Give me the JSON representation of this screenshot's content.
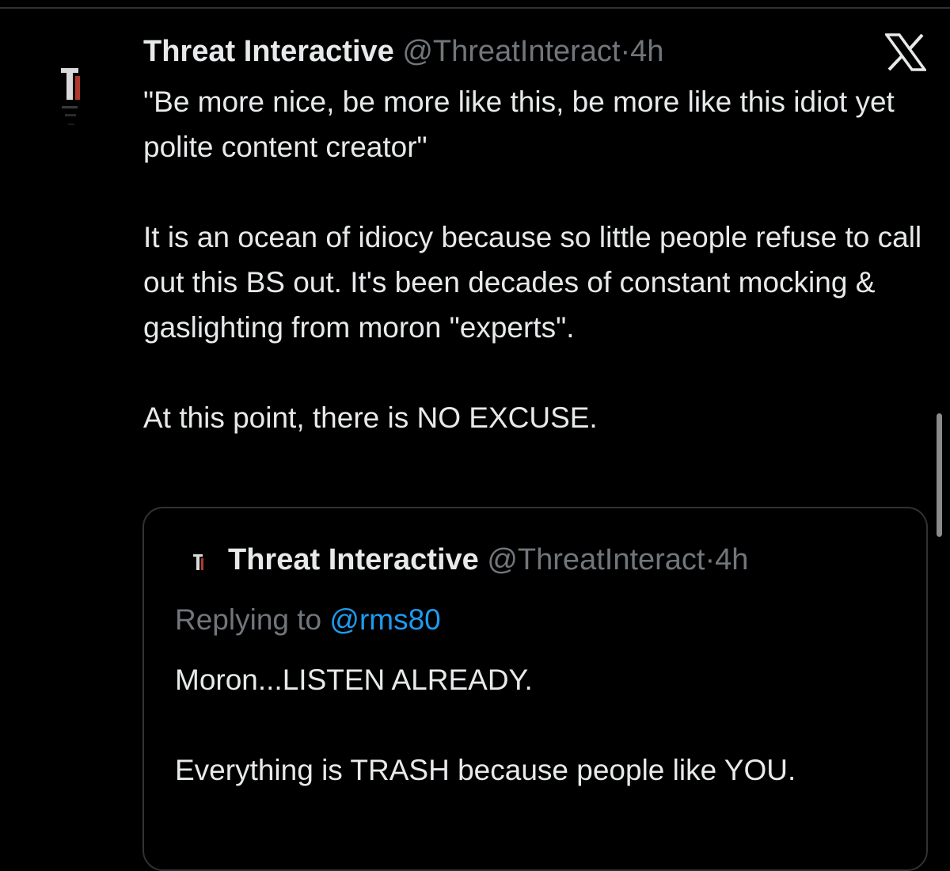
{
  "tweet": {
    "display_name": "Threat Interactive",
    "handle": "@ThreatInteract",
    "separator": "·",
    "time": "4h",
    "text": "\"Be more nice, be more like this, be more like this idiot yet polite content creator\"\n\nIt is an ocean of idiocy because so little people refuse to call out this BS out. It's been decades of constant mocking & gaslighting from moron \"experts\".\n\nAt this point, there is NO EXCUSE."
  },
  "quoted_tweet": {
    "display_name": "Threat Interactive",
    "handle": "@ThreatInteract",
    "separator": "·",
    "time": "4h",
    "replying_prefix": "Replying to ",
    "replying_mention": "@rms80",
    "text": "Moron...LISTEN ALREADY.\n\nEverything is TRASH because people like YOU."
  },
  "icons": {
    "avatar": "threat-interactive-logo",
    "close": "x-logo-icon"
  },
  "colors": {
    "background": "#000000",
    "text": "#e7e9ea",
    "muted": "#71767b",
    "link": "#1d9bf0",
    "border": "#2f3336",
    "avatar_accent": "#c0392b"
  }
}
